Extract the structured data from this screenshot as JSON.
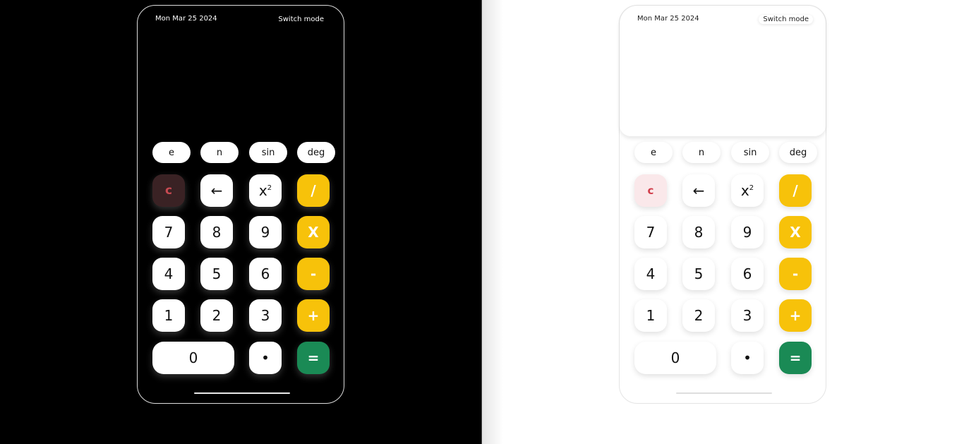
{
  "date": "Mon Mar 25 2024",
  "switch_label": "Switch mode",
  "sci_keys": [
    "e",
    "n",
    "sin",
    "deg"
  ],
  "keys": {
    "clear": "c",
    "backspace": "←",
    "square_base": "x",
    "square_exp": "2",
    "divide": "/",
    "seven": "7",
    "eight": "8",
    "nine": "9",
    "multiply": "X",
    "four": "4",
    "five": "5",
    "six": "6",
    "minus": "-",
    "one": "1",
    "two": "2",
    "three": "3",
    "plus": "+",
    "zero": "0",
    "dot": "•",
    "equals": "="
  },
  "colors": {
    "operator": "#f7c20a",
    "equals": "#1a8a55",
    "clear_text": "#d13d4a"
  }
}
